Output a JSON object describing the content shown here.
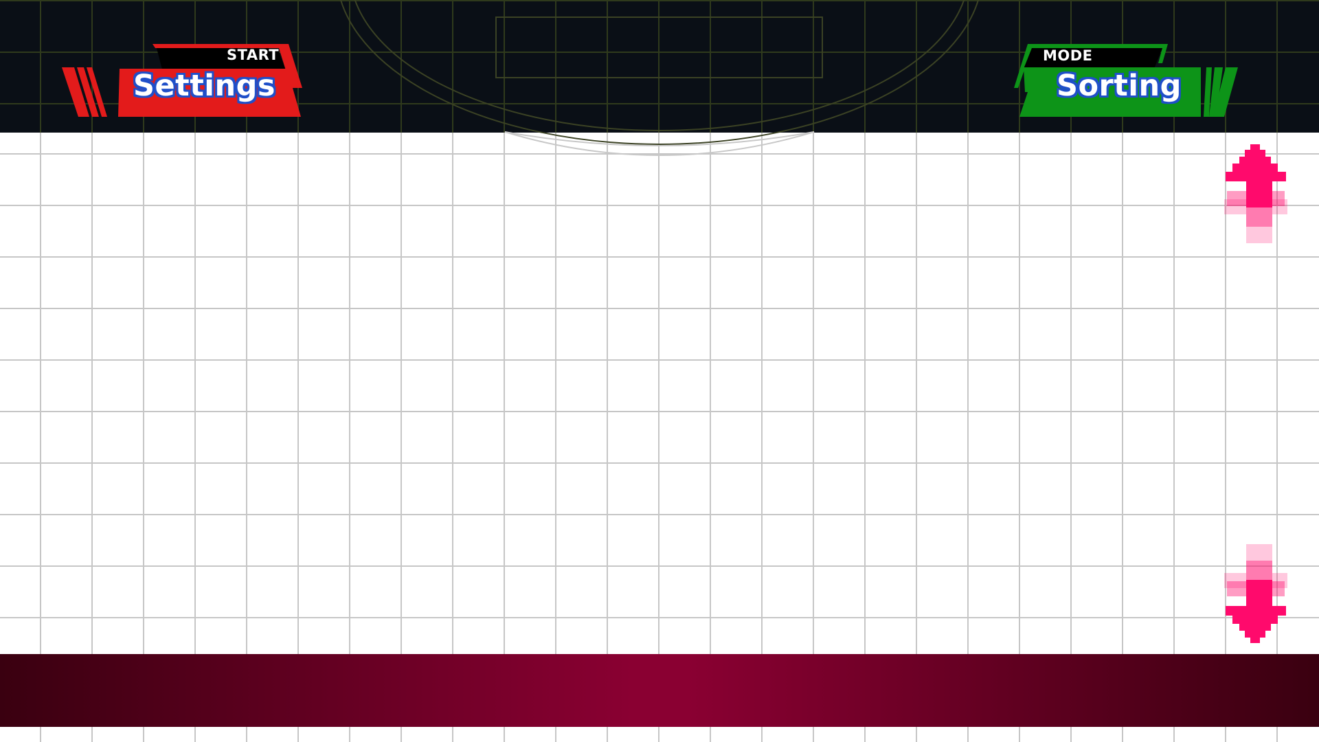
{
  "header": {
    "left_button": {
      "hint": "START",
      "label": "Settings",
      "color": "#e31b1b"
    },
    "right_button": {
      "hint": "MODE",
      "label": "Sorting",
      "color": "#0d9418"
    }
  },
  "controls": {
    "scroll_up_icon": "arrow-up-icon",
    "scroll_down_icon": "arrow-down-icon",
    "arrow_color": "#ff0a6c"
  },
  "theme": {
    "background": "#ffffff",
    "topbar": "#0a0f16",
    "footer_gradient": [
      "#3a0010",
      "#8a0032"
    ]
  }
}
